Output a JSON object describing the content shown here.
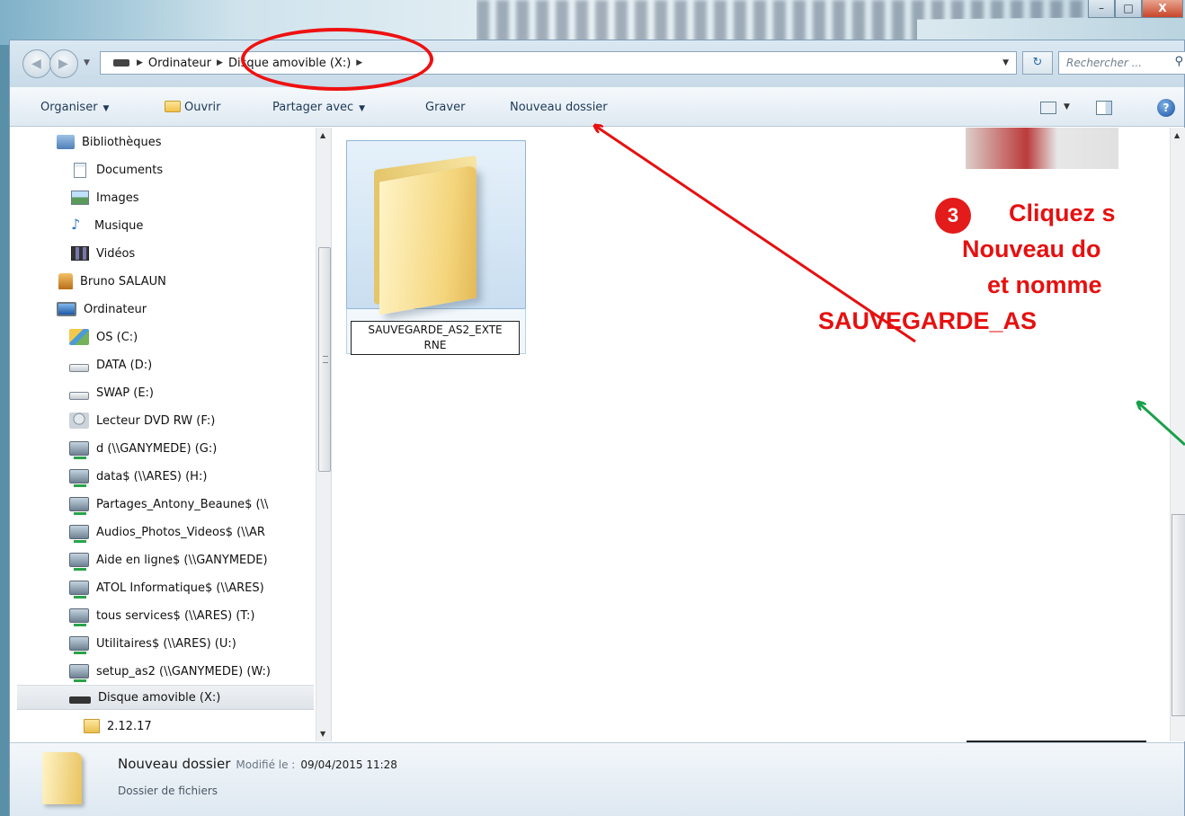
{
  "window": {
    "caption_buttons": [
      "–",
      "□",
      "X"
    ]
  },
  "addressbar": {
    "crumbs": [
      "Ordinateur",
      "Disque amovible (X:)"
    ],
    "search_placeholder": "Rechercher ..."
  },
  "toolbar": {
    "organiser": "Organiser",
    "ouvrir": "Ouvrir",
    "partager": "Partager avec",
    "graver": "Graver",
    "nouveau_dossier": "Nouveau dossier",
    "help": "?"
  },
  "nav": {
    "items": [
      {
        "label": "Bibliothèques",
        "icon": "library-icon"
      },
      {
        "label": "Documents",
        "icon": "documents-icon"
      },
      {
        "label": "Images",
        "icon": "images-icon"
      },
      {
        "label": "Musique",
        "icon": "music-icon"
      },
      {
        "label": "Vidéos",
        "icon": "videos-icon"
      },
      {
        "label": "Bruno SALAUN",
        "icon": "user-icon"
      },
      {
        "label": "Ordinateur",
        "icon": "computer-icon"
      },
      {
        "label": "OS (C:)",
        "icon": "os-drive-icon"
      },
      {
        "label": "DATA (D:)",
        "icon": "hard-drive-icon"
      },
      {
        "label": "SWAP (E:)",
        "icon": "hard-drive-icon"
      },
      {
        "label": "Lecteur DVD RW (F:)",
        "icon": "dvd-drive-icon"
      },
      {
        "label": "d (\\\\GANYMEDE) (G:)",
        "icon": "network-drive-icon"
      },
      {
        "label": "data$ (\\\\ARES) (H:)",
        "icon": "network-drive-icon"
      },
      {
        "label": "Partages_Antony_Beaune$ (\\\\",
        "icon": "network-drive-icon"
      },
      {
        "label": "Audios_Photos_Videos$ (\\\\AR",
        "icon": "network-drive-icon"
      },
      {
        "label": "Aide en ligne$ (\\\\GANYMEDE)",
        "icon": "network-drive-icon"
      },
      {
        "label": "ATOL Informatique$ (\\\\ARES)",
        "icon": "network-drive-icon"
      },
      {
        "label": "tous services$ (\\\\ARES) (T:)",
        "icon": "network-drive-icon"
      },
      {
        "label": "Utilitaires$ (\\\\ARES) (U:)",
        "icon": "network-drive-icon"
      },
      {
        "label": "setup_as2 (\\\\GANYMEDE) (W:)",
        "icon": "network-drive-icon"
      },
      {
        "label": "Disque amovible (X:)",
        "icon": "removable-drive-icon",
        "selected": true
      },
      {
        "label": "2.12.17",
        "icon": "folder-icon"
      }
    ]
  },
  "content": {
    "folder_name_line1": "SAUVEGARDE_AS2_EXTE",
    "folder_name_line2": "RNE"
  },
  "instruction": {
    "step_number": "3",
    "line1": "Cliquez s",
    "line2": "Nouveau do",
    "line3": "et nomme",
    "line4": "SAUVEGARDE_AS"
  },
  "details": {
    "name": "Nouveau dossier",
    "modified_label": "Modifié le :",
    "modified_value": "09/04/2015 11:28",
    "type": "Dossier de fichiers"
  },
  "colors": {
    "annotation_red": "#e61010",
    "annotation_green": "#1aa04a"
  }
}
